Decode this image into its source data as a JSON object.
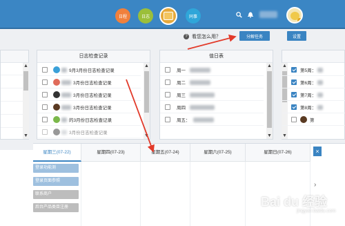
{
  "topbar": {
    "nav": [
      {
        "label": "日程",
        "color": "#f0803c"
      },
      {
        "label": "日志",
        "color": "#9bbf3a"
      },
      {
        "label": "",
        "color": "#e6a93b",
        "active": true
      },
      {
        "label": "同事",
        "color": "#2fa6d9"
      }
    ],
    "icons": [
      "search-icon",
      "bell-icon",
      "user-avatar"
    ]
  },
  "helpbar": {
    "help_text": "看您怎么用？",
    "decompose_task_label": "分解任务",
    "settings_label": "设置"
  },
  "left_panel": {
    "rows": [
      "",
      "",
      "",
      "",
      ""
    ]
  },
  "log_panel": {
    "title": "日志检查记录",
    "rows": [
      {
        "text": "9月3月份日志检查记录",
        "checked": false,
        "avatar_color": "#3aa0d8"
      },
      {
        "text": "3月份日志检查记录",
        "checked": false,
        "avatar_color": "#e06b5a"
      },
      {
        "text": "3月份日志检查记录",
        "checked": false,
        "avatar_color": "#333333"
      },
      {
        "text": "3月份日志检查记录",
        "checked": false,
        "avatar_color": "#5a3a22"
      },
      {
        "text": "的3月份日志检查记录",
        "checked": false,
        "avatar_color": "#7bb84a"
      },
      {
        "text": "3月份日志检查记录",
        "checked": false,
        "avatar_color": "#444444"
      }
    ]
  },
  "duty_panel": {
    "title": "值日表",
    "rows": [
      {
        "text": "周一",
        "checked": false
      },
      {
        "text": "周二",
        "checked": false
      },
      {
        "text": "周三",
        "checked": false
      },
      {
        "text": "周四",
        "checked": false
      },
      {
        "text": "周五：",
        "checked": false
      }
    ]
  },
  "right_panel": {
    "rows": [
      {
        "text": "第5周：",
        "checked": true
      },
      {
        "text": "第6周：",
        "checked": true
      },
      {
        "text": "第7周：",
        "checked": true
      },
      {
        "text": "第8周：",
        "checked": true
      },
      {
        "text": "第",
        "checked": false
      }
    ]
  },
  "week": {
    "days": [
      {
        "label": "星期三(07-22)",
        "active": true
      },
      {
        "label": "星期四(07-23)",
        "active": false
      },
      {
        "label": "星期五(07-24)",
        "active": false
      },
      {
        "label": "星期六(07-25)",
        "active": false
      },
      {
        "label": "星期日(07-26)",
        "active": false
      }
    ],
    "tasks": [
      {
        "text": "登录功能测",
        "style": "blue"
      },
      {
        "text": "登录页面参照",
        "style": "blue"
      },
      {
        "text": "联系商户",
        "style": "gray"
      },
      {
        "text": "后台产品类目注册",
        "style": "gray"
      }
    ],
    "close_label": "×"
  },
  "watermark": {
    "text": "Bai du 经验",
    "sub": "jingyan.baidu.com"
  }
}
